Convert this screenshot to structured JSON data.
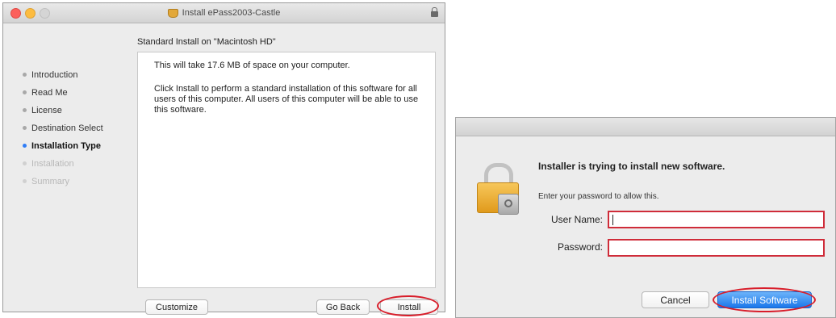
{
  "installer": {
    "window_title": "Install ePass2003-Castle",
    "heading": "Standard Install on \"Macintosh HD\"",
    "steps": [
      {
        "label": "Introduction",
        "state": "done"
      },
      {
        "label": "Read Me",
        "state": "done"
      },
      {
        "label": "License",
        "state": "done"
      },
      {
        "label": "Destination Select",
        "state": "done"
      },
      {
        "label": "Installation Type",
        "state": "active"
      },
      {
        "label": "Installation",
        "state": "future"
      },
      {
        "label": "Summary",
        "state": "future"
      }
    ],
    "space_text": "This will take 17.6 MB of space on your computer.",
    "description": "Click Install to perform a standard installation of this software for all users of this computer. All users of this computer will be able to use this software.",
    "buttons": {
      "customize": "Customize",
      "go_back": "Go Back",
      "install": "Install"
    }
  },
  "auth_dialog": {
    "title": "Installer is trying to install new software.",
    "subtitle": "Enter your password to allow this.",
    "username_label": "User Name:",
    "username_value": "",
    "password_label": "Password:",
    "password_value": "",
    "cancel_label": "Cancel",
    "install_software_label": "Install Software"
  },
  "colors": {
    "highlight_red": "#d81d2a",
    "active_step_dot": "#2f7df6",
    "default_button_blue": "#1b77ea",
    "lock_gold": "#e09a1c"
  },
  "icons": [
    "package-icon",
    "lock-icon",
    "padlock-icon"
  ]
}
